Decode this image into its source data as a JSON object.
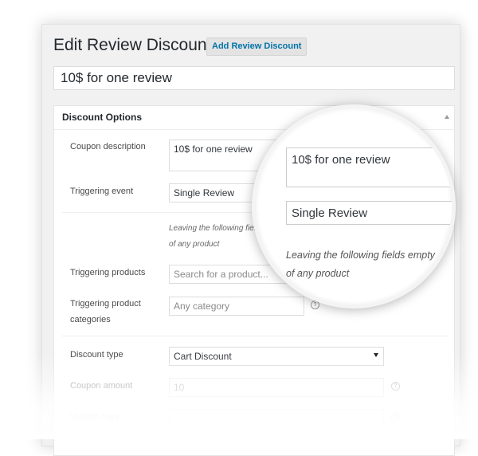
{
  "header": {
    "title": "Edit Review Discount",
    "add_button": "Add Review Discount"
  },
  "post_title": "10$ for one review",
  "discount_options": {
    "heading": "Discount Options",
    "coupon_description": {
      "label": "Coupon description",
      "value": "10$ for one review"
    },
    "triggering_event": {
      "label": "Triggering event",
      "value": "Single Review"
    },
    "note_line1": "Leaving the following fields empty",
    "note_line2": "of any product",
    "note_line1_clipped": "Leaving the following fiel",
    "triggering_products": {
      "label": "Triggering products",
      "placeholder": "Search for a product..."
    },
    "triggering_categories": {
      "label_line1": "Triggering product",
      "label_line2": "categories",
      "placeholder": "Any category"
    },
    "discount_type": {
      "label": "Discount type",
      "value": "Cart Discount"
    },
    "coupon_amount": {
      "label": "Coupon amount",
      "value": "10"
    },
    "validity": {
      "label": "Validity days"
    }
  },
  "icons": {
    "help": "?"
  },
  "colors": {
    "link": "#0073aa",
    "background": "#f1f1f1"
  }
}
